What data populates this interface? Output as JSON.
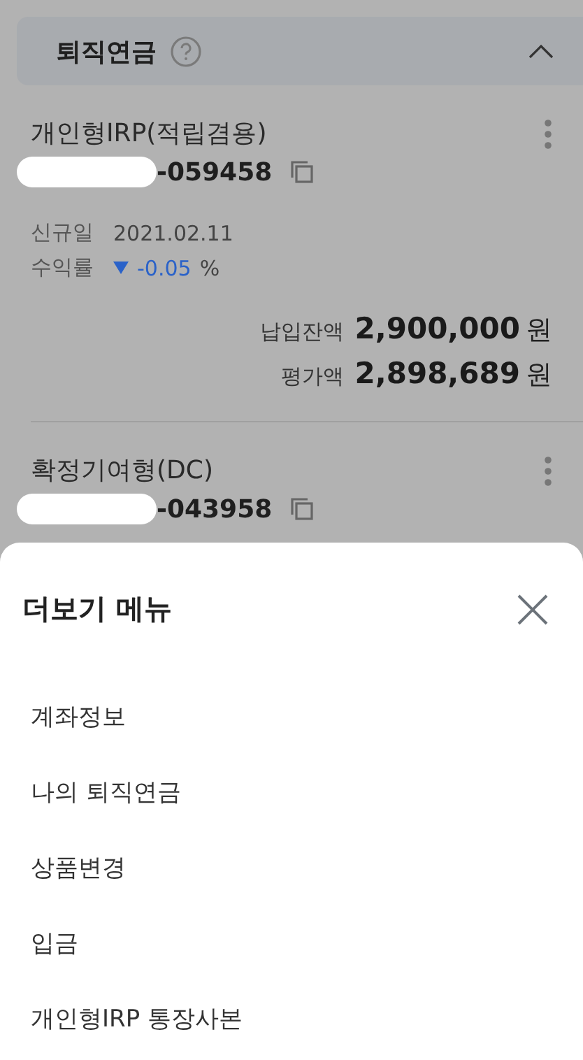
{
  "section": {
    "title": "퇴직연금",
    "expanded": true
  },
  "accounts": [
    {
      "name": "개인형IRP(적립겸용)",
      "number": "-059458",
      "redacted": true,
      "details": [
        {
          "label": "신규일",
          "value": "2021.02.11",
          "kind": "plain"
        },
        {
          "label": "수익률",
          "value": "-0.05",
          "unit": "%",
          "kind": "rate",
          "negative": true
        }
      ],
      "amounts": [
        {
          "label": "납입잔액",
          "value": "2,900,000",
          "unit": "원"
        },
        {
          "label": "평가액",
          "value": "2,898,689",
          "unit": "원"
        }
      ]
    },
    {
      "name": "확정기여형(DC)",
      "number": "-043958",
      "redacted": true
    }
  ],
  "sheet": {
    "title": "더보기 메뉴",
    "items": [
      "계좌정보",
      "나의 퇴직연금",
      "상품변경",
      "입금",
      "개인형IRP 통장사본"
    ]
  }
}
